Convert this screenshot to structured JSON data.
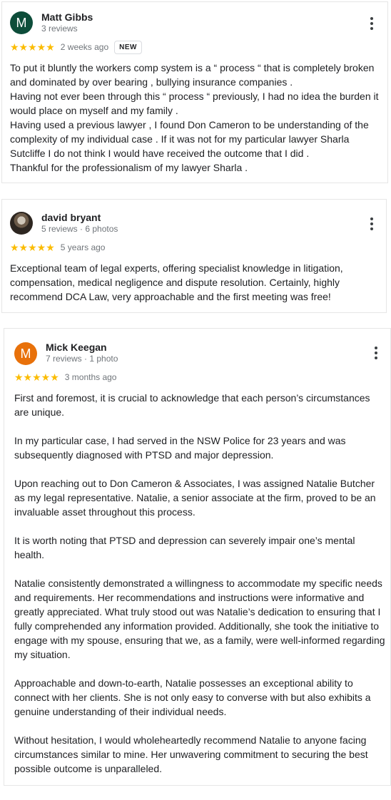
{
  "reviews": [
    {
      "avatar_letter": "M",
      "avatar_color": "#0d4d3a",
      "name": "Matt Gibbs",
      "sub": "3 reviews",
      "stars": "★★★★★",
      "date": "2 weeks ago",
      "badge": "NEW",
      "paragraphs": [
        "To put it bluntly the workers comp system is a “ process “ that is completely broken and dominated by over bearing , bullying insurance companies .",
        "Having not ever been through this “ process “ previously, I had no idea the burden it would place on myself and my family .",
        "Having used a previous lawyer , I found Don Cameron to be understanding of the complexity of my individual case . If it was not for my particular lawyer Sharla Sutcliffe I do not think I would have received the outcome that I did .",
        "Thankful for the professionalism of my lawyer Sharla ."
      ]
    },
    {
      "name": "david bryant",
      "sub": "5 reviews · 6 photos",
      "stars": "★★★★★",
      "date": "5 years ago",
      "paragraphs": [
        "Exceptional team of legal experts, offering specialist knowledge in litigation, compensation, medical negligence and dispute resolution. Certainly, highly recommend DCA Law, very approachable and the first meeting was free!"
      ]
    },
    {
      "avatar_letter": "M",
      "avatar_color": "#e8710a",
      "name": "Mick Keegan",
      "sub": "7 reviews · 1 photo",
      "stars": "★★★★★",
      "date": "3 months ago",
      "paragraphs": [
        "First and foremost, it is crucial to acknowledge that each person’s circumstances are unique.",
        "In my particular case, I had served in the NSW Police for 23 years and was subsequently diagnosed with PTSD and major depression.",
        "Upon reaching out to Don Cameron & Associates, I was assigned Natalie Butcher as my legal representative. Natalie, a senior associate at the firm, proved to be an invaluable asset throughout this process.",
        "It is worth noting that PTSD and depression can severely impair one’s mental health.",
        "Natalie consistently demonstrated a willingness to accommodate my specific needs and requirements. Her recommendations and instructions were informative and greatly appreciated. What truly stood out was Natalie’s dedication to ensuring that I fully comprehended any information provided. Additionally, she took the initiative to engage with my spouse, ensuring that we, as a family, were well-informed regarding my situation.",
        "Approachable and down-to-earth, Natalie possesses an exceptional ability to connect with her clients. She is not only easy to converse with but also exhibits a genuine understanding of their individual needs.",
        "Without hesitation, I would wholeheartedly recommend Natalie to anyone facing circumstances similar to mine. Her unwavering commitment to securing the best possible outcome is unparalleled."
      ]
    }
  ]
}
